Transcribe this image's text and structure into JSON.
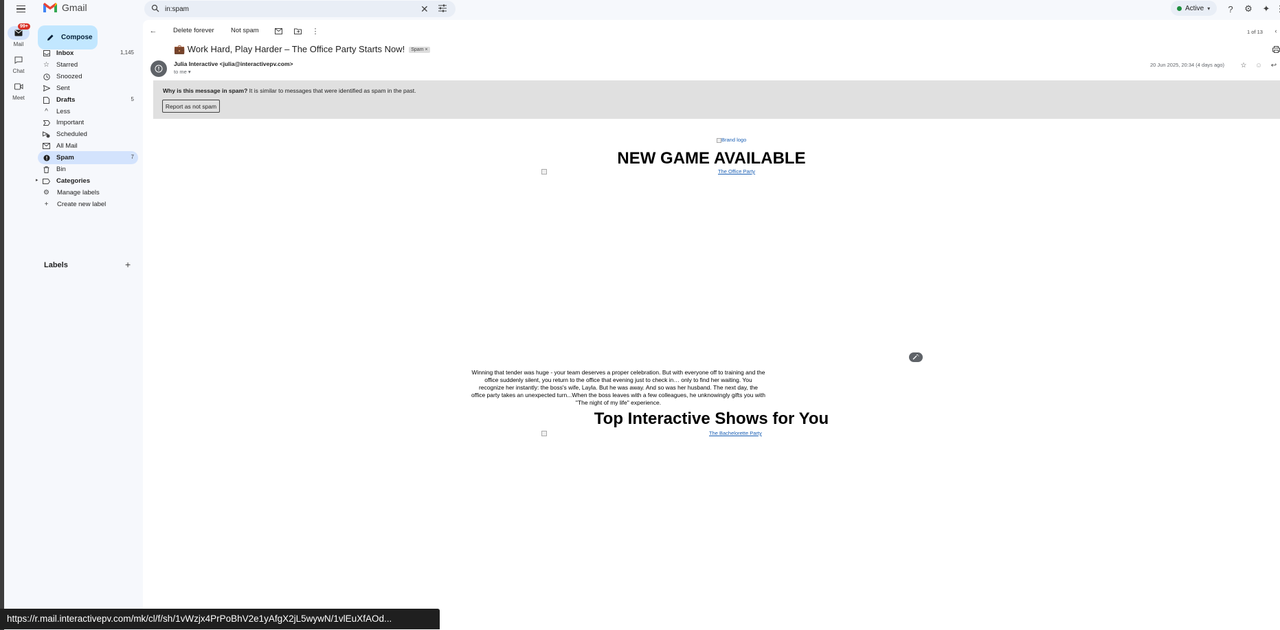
{
  "app": {
    "name": "Gmail"
  },
  "search": {
    "value": "in:spam"
  },
  "status": {
    "label": "Active"
  },
  "rail": {
    "mail_label": "Mail",
    "mail_badge": "99+",
    "chat_label": "Chat",
    "meet_label": "Meet"
  },
  "sidebar": {
    "compose_label": "Compose",
    "items": [
      {
        "label": "Inbox",
        "count": "1,145",
        "icon": "inbox-icon"
      },
      {
        "label": "Starred",
        "count": "",
        "icon": "star-icon"
      },
      {
        "label": "Snoozed",
        "count": "",
        "icon": "clock-icon"
      },
      {
        "label": "Sent",
        "count": "",
        "icon": "send-icon"
      },
      {
        "label": "Drafts",
        "count": "5",
        "icon": "draft-icon"
      },
      {
        "label": "Less",
        "count": "",
        "icon": "chevron-up-icon"
      },
      {
        "label": "Important",
        "count": "",
        "icon": "important-icon"
      },
      {
        "label": "Scheduled",
        "count": "",
        "icon": "scheduled-icon"
      },
      {
        "label": "All Mail",
        "count": "",
        "icon": "all-mail-icon"
      },
      {
        "label": "Spam",
        "count": "7",
        "icon": "spam-icon"
      },
      {
        "label": "Bin",
        "count": "",
        "icon": "bin-icon"
      },
      {
        "label": "Categories",
        "count": "",
        "icon": "label-icon"
      },
      {
        "label": "Manage labels",
        "count": "",
        "icon": "gear-icon"
      },
      {
        "label": "Create new label",
        "count": "",
        "icon": "plus-icon"
      }
    ],
    "labels_heading": "Labels"
  },
  "toolbar": {
    "delete_forever": "Delete forever",
    "not_spam": "Not spam",
    "pager": "1 of 13"
  },
  "email": {
    "subject": "💼 Work Hard, Play Harder – The Office Party Starts Now!",
    "chip": "Spam ×",
    "sender": "Julia Interactive <julia@interactivepv.com>",
    "to": "to me ▾",
    "date": "20 Jun 2025, 20:34 (4 days ago)",
    "spam_question": "Why is this message in spam?",
    "spam_reason": " It is similar to messages that were identified as spam in the past.",
    "report_button": "Report as not spam",
    "brand_logo_alt": "Brand logo",
    "headline": "NEW GAME AVAILABLE",
    "game_link": "The Office Party",
    "body": "Winning that tender was huge - your team deserves a proper celebration. But with everyone off to training and the office suddenly silent, you return to the office that evening just to check in… only to find her waiting. You recognize her instantly: the boss's wife, Layla. But he was away. And so was her husband. The next day, the office party takes an unexpected turn...When the boss leaves with a few colleagues, he unknowingly gifts you with \"The night of my life\" experience.",
    "headline2": "Top Interactive Shows for You",
    "show_link": "The Bachelorette Party"
  },
  "statusbar": {
    "url": "https://r.mail.interactivepv.com/mk/cl/f/sh/1vWzjx4PrPoBhV2e1yAfgX2jL5wywN/1vlEuXfAOd..."
  },
  "colors": {
    "compose_bg": "#c2e7ff",
    "active_nav_bg": "#d3e3fd",
    "banner_bg": "#e0e0e0",
    "link": "#1a5fb4",
    "badge": "#d93025",
    "status_green": "#1e8e3e"
  }
}
